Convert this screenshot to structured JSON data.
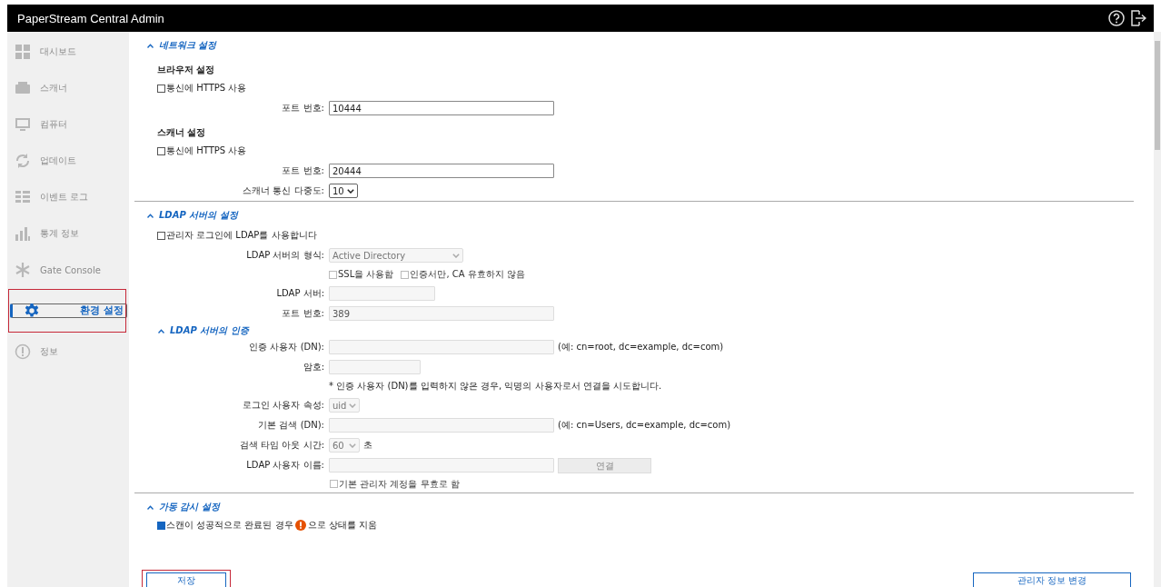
{
  "window": {
    "title": "PaperStream Central Admin"
  },
  "sidebar": {
    "items": [
      {
        "label": "대시보드",
        "selected": false
      },
      {
        "label": "스캐너",
        "selected": false
      },
      {
        "label": "컴퓨터",
        "selected": false
      },
      {
        "label": "업데이트",
        "selected": false
      },
      {
        "label": "이벤트 로그",
        "selected": false
      },
      {
        "label": "통계 정보",
        "selected": false
      },
      {
        "label": "Gate Console",
        "selected": false
      },
      {
        "label": "환경 설정",
        "selected": true
      },
      {
        "label": "정보",
        "selected": false
      }
    ]
  },
  "sections": [
    {
      "title": "네트워크 설정",
      "expanded": true,
      "rows": [
        {
          "kind": "subheading",
          "label": "브라우저 설정"
        },
        {
          "kind": "checkbox",
          "label": "통신에 HTTPS 사용",
          "checked": false,
          "disabled": false
        },
        {
          "kind": "field",
          "label": "포트 번호:",
          "value": "10444",
          "disabled": false
        },
        {
          "kind": "subheading",
          "label": "스캐너 설정"
        },
        {
          "kind": "checkbox",
          "label": "통신에 HTTPS 사용",
          "checked": false,
          "disabled": false
        },
        {
          "kind": "field",
          "label": "포트 번호:",
          "value": "20444",
          "disabled": false
        },
        {
          "kind": "select",
          "label": "스캐너 통신 다중도:",
          "value": "10",
          "disabled": false
        }
      ]
    },
    {
      "title": "LDAP 서버의 설정",
      "expanded": true,
      "rows": [
        {
          "kind": "checkbox",
          "label": "관리자 로그인에 LDAP를 사용합니다",
          "checked": false,
          "disabled": false
        },
        {
          "kind": "select",
          "label": "LDAP 서버의 형식:",
          "value": "Active Directory",
          "disabled": true
        },
        {
          "kind": "checkbox_pair",
          "items": [
            {
              "label": "SSL을 사용함",
              "checked": false,
              "disabled": true
            },
            {
              "label": "인증서만, CA 유효하지 않음",
              "checked": false,
              "disabled": true
            }
          ]
        },
        {
          "kind": "field",
          "label": "LDAP 서버:",
          "value": "",
          "disabled": true
        },
        {
          "kind": "field",
          "label": "포트 번호:",
          "value": "389",
          "disabled": true
        },
        {
          "kind": "subsection",
          "title": "LDAP 서버의 인증",
          "expanded": true
        },
        {
          "kind": "field",
          "label": "인증 사용자 (DN):",
          "value": "",
          "disabled": true,
          "hint": "(예: cn=root, dc=example, dc=com)"
        },
        {
          "kind": "field",
          "label": "암호:",
          "value": "",
          "disabled": true
        },
        {
          "kind": "note",
          "text": "* 인증 사용자 (DN)를 입력하지 않은 경우, 익명의 사용자로서 연결을 시도합니다."
        },
        {
          "kind": "select",
          "label": "로그인 사용자 속성:",
          "value": "uid",
          "disabled": true
        },
        {
          "kind": "field",
          "label": "기본 검색 (DN):",
          "value": "",
          "disabled": true,
          "hint": "(예: cn=Users, dc=example, dc=com)"
        },
        {
          "kind": "select",
          "label": "검색 타임 아웃 시간:",
          "value": "60",
          "disabled": true,
          "suffix": "초"
        },
        {
          "kind": "field",
          "label": "LDAP 사용자 이름:",
          "value": "",
          "disabled": true,
          "button": "연결"
        },
        {
          "kind": "option",
          "label": "기본 관리자 계정을 무효로 함",
          "checked": false,
          "disabled": true
        }
      ]
    },
    {
      "title": "가동 감시 설정",
      "expanded": true,
      "rows": [
        {
          "kind": "checkbox_warn",
          "before": "스캔이 성공적으로 완료된 경우",
          "after": "으로 상태를 지움",
          "checked": true
        }
      ]
    }
  ],
  "footer": {
    "save": "저장",
    "admin": "관리자 정보 변경"
  }
}
